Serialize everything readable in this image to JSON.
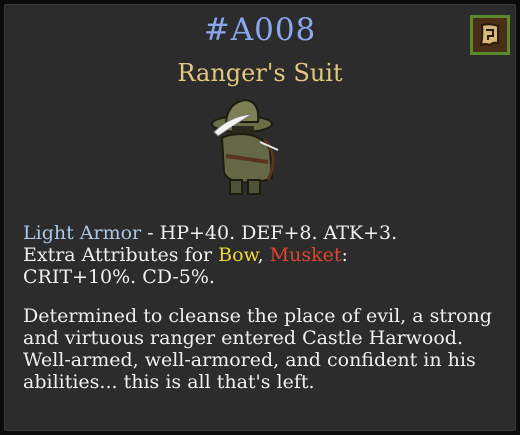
{
  "item": {
    "id": "#A008",
    "name": "Ranger's Suit"
  },
  "stats": {
    "armor_type": "Light Armor",
    "base": " - HP+40. DEF+8. ATK+3.",
    "extra_prefix": "Extra Attributes for ",
    "weapon_1": "Bow",
    "separator": ", ",
    "weapon_2": "Musket",
    "colon": ":",
    "extra_values": "CRIT+10%. CD-5%."
  },
  "lore": "Determined to cleanse the place of evil, a strong and virtuous ranger entered Castle Harwood. Well-armed, well-armored, and confident in his abilities... this is all that's left.",
  "icons": {
    "map_button": "map-icon",
    "sprite": "ranger-suit-sprite"
  },
  "colors": {
    "id": "#8aa8f0",
    "name": "#e3c77c",
    "armor_type": "#a9c7e4",
    "bow": "#f0d63a",
    "musket": "#e0452f",
    "text": "#f0f0f0",
    "panel": "#2c2c2c"
  }
}
